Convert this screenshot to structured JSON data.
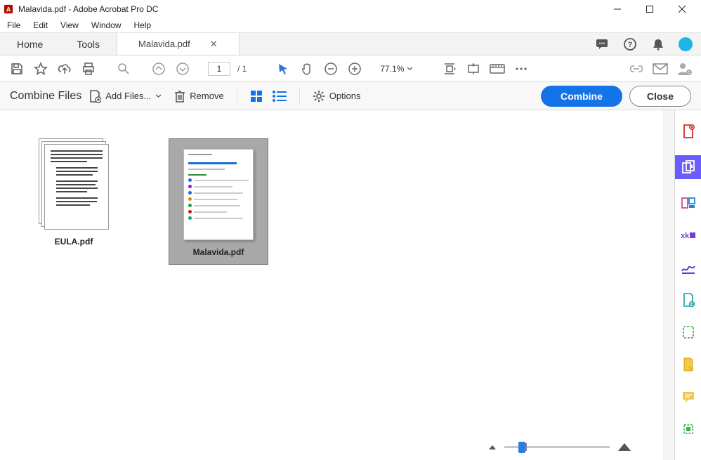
{
  "window": {
    "title": "Malavida.pdf - Adobe Acrobat Pro DC"
  },
  "menu": {
    "file": "File",
    "edit": "Edit",
    "view": "View",
    "window": "Window",
    "help": "Help"
  },
  "tabs": {
    "home": "Home",
    "tools": "Tools",
    "doc": "Malavida.pdf"
  },
  "toolbar": {
    "page_current": "1",
    "page_total": "/  1",
    "zoom": "77.1%"
  },
  "panel": {
    "title": "Combine Files",
    "add_files": "Add Files...",
    "remove": "Remove",
    "options": "Options",
    "combine": "Combine",
    "close": "Close"
  },
  "files": [
    {
      "name": "EULA.pdf",
      "selected": false
    },
    {
      "name": "Malavida.pdf",
      "selected": true
    }
  ]
}
